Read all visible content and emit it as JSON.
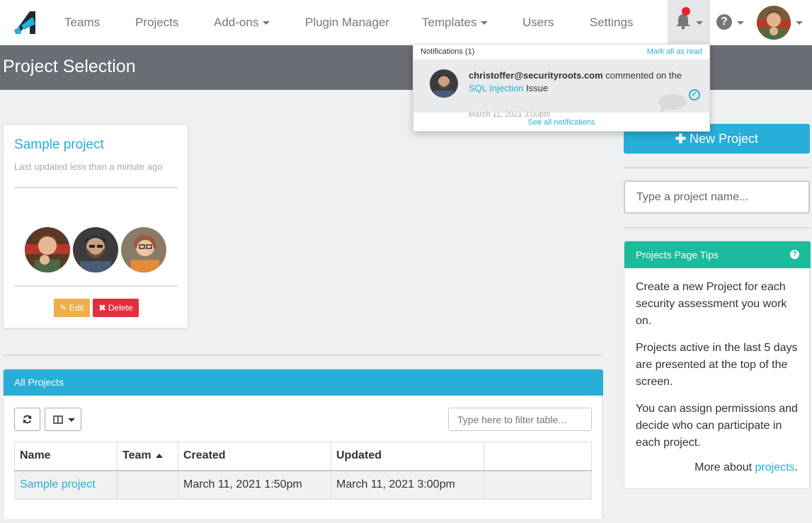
{
  "nav": {
    "items": [
      {
        "label": "Teams",
        "dropdown": false
      },
      {
        "label": "Projects",
        "dropdown": false
      },
      {
        "label": "Add-ons",
        "dropdown": true
      },
      {
        "label": "Plugin Manager",
        "dropdown": false
      },
      {
        "label": "Templates",
        "dropdown": true
      },
      {
        "label": "Users",
        "dropdown": false
      },
      {
        "label": "Settings",
        "dropdown": false
      }
    ],
    "help_glyph": "?"
  },
  "header": {
    "title": "Project Selection"
  },
  "notifications": {
    "title": "Notifications (1)",
    "mark_all": "Mark all as read",
    "item": {
      "user": "christoffer@securityroots.com",
      "action": "commented on the",
      "link": "SQL Injection",
      "object": "Issue",
      "time": "March 11, 2021 3:00pm"
    },
    "see_all": "See all notifications"
  },
  "card": {
    "title": "Sample project",
    "subtitle": "Last updated less than a minute ago",
    "edit_label": "Edit",
    "delete_label": "Delete"
  },
  "all_projects": {
    "title": "All Projects",
    "filter_placeholder": "Type here to filter table...",
    "columns": [
      "Name",
      "Team",
      "Created",
      "Updated",
      ""
    ],
    "rows": [
      {
        "name": "Sample project",
        "team": "",
        "created": "March 11, 2021 1:50pm",
        "updated": "March 11, 2021 3:00pm"
      }
    ]
  },
  "sidebar": {
    "new_project": "New Project",
    "search_placeholder": "Type a project name...",
    "tips_title": "Projects Page Tips",
    "tips": [
      "Create a new Project for each security assessment you work on.",
      "Projects active in the last 5 days are presented at the top of the screen.",
      "You can assign permissions and decide who can participate in each project."
    ],
    "more_prefix": "More about",
    "more_link": "projects",
    "more_suffix": "."
  },
  "colors": {
    "accent": "#27aed9",
    "teal": "#1abc9c",
    "header": "#6a6d73",
    "edit": "#f0ad4e",
    "delete": "#e0303f",
    "badge": "#e9232a"
  },
  "icons": [
    "logo-icon",
    "caret-down-icon",
    "bell-icon",
    "help-icon",
    "check-circle-icon",
    "comment-bubble-icon",
    "pencil-icon",
    "times-icon",
    "refresh-icon",
    "columns-icon",
    "plus-icon",
    "sort-asc-icon",
    "question-icon"
  ]
}
